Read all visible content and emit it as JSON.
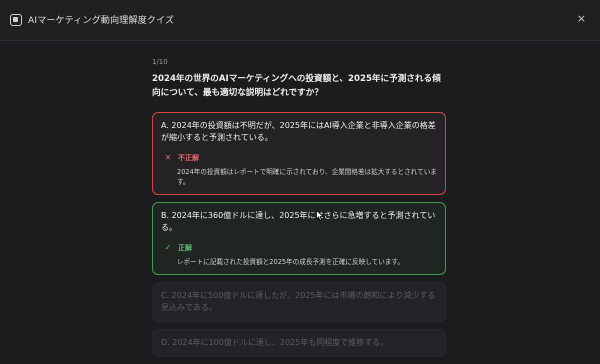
{
  "header": {
    "title": "AIマーケティング動向理解度クイズ",
    "close_label": "×"
  },
  "quiz": {
    "progress": "1/10",
    "question": "2024年の世界のAIマーケティングへの投資額と、2025年に予測される傾向について、最も適切な説明はどれですか？",
    "options": [
      {
        "label": "A. 2024年の投資額は不明だが、2025年にはAI導入企業と非導入企業の格差が縮小すると予測されている。",
        "state": "incorrect",
        "feedback_title": "不正解",
        "feedback_text": "2024年の投資額はレポートで明確に示されており、企業間格差は拡大するとされています。"
      },
      {
        "label": "B. 2024年に360億ドルに達し、2025年にはさらに急増すると予測されている。",
        "state": "correct",
        "feedback_title": "正解",
        "feedback_text": "レポートに記載された投資額と2025年の成長予測を正確に反映しています。"
      },
      {
        "label": "C. 2024年に500億ドルに達したが、2025年には市場の飽和により減少する見込みである。",
        "state": "disabled"
      },
      {
        "label": "D. 2024年に100億ドルに達し、2025年も同程度で推移する。",
        "state": "disabled"
      }
    ]
  },
  "colors": {
    "incorrect": "#d0444b",
    "correct": "#3d9a55",
    "background": "#1b1c1e"
  },
  "icons": {
    "app": "quiz-app-icon",
    "close": "close-icon",
    "incorrect": "cross-icon",
    "correct": "check-icon"
  }
}
